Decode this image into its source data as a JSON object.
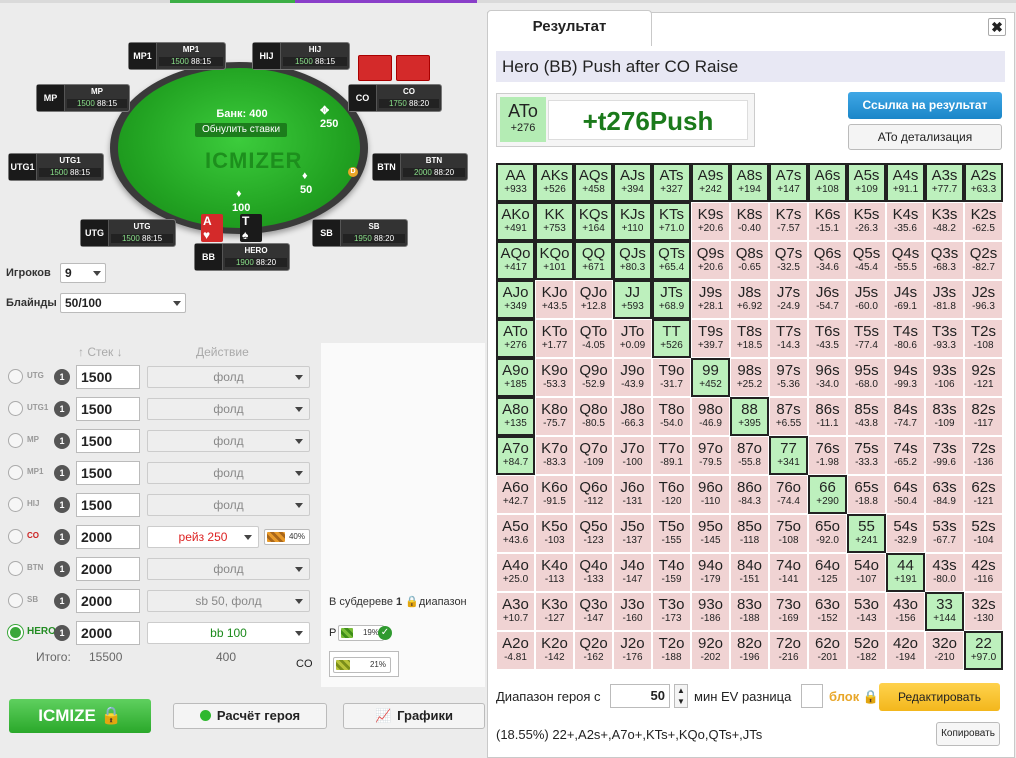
{
  "table": {
    "bank": "Банк: 400",
    "reset": "Обнулить ставки",
    "watermark": "ICMIZER",
    "pot_mp1": "250",
    "pot_btn": "50",
    "pot_hero": "100",
    "dealer": "D"
  },
  "seats": [
    {
      "key": "mp1",
      "pos": "MP1",
      "name": "MP1",
      "stack": "1500",
      "extra": "88:15"
    },
    {
      "key": "hij",
      "pos": "HIJ",
      "name": "HIJ",
      "stack": "1500",
      "extra": "88:15"
    },
    {
      "key": "mp",
      "pos": "MP",
      "name": "MP",
      "stack": "1500",
      "extra": "88:15"
    },
    {
      "key": "co",
      "pos": "CO",
      "name": "CO",
      "stack": "1750",
      "extra": "88:20"
    },
    {
      "key": "utg1",
      "pos": "UTG1",
      "name": "UTG1",
      "stack": "1500",
      "extra": "88:15"
    },
    {
      "key": "btn",
      "pos": "BTN",
      "name": "BTN",
      "stack": "2000",
      "extra": "88:20"
    },
    {
      "key": "utg",
      "pos": "UTG",
      "name": "UTG",
      "stack": "1500",
      "extra": "88:15"
    },
    {
      "key": "sb",
      "pos": "SB",
      "name": "SB",
      "stack": "1950",
      "extra": "88:20"
    },
    {
      "key": "bb",
      "pos": "BB",
      "name": "HERO",
      "stack": "1900",
      "extra": "88:20"
    }
  ],
  "hero_cards": [
    "A",
    "T"
  ],
  "settings": {
    "players_label": "Игроков",
    "players": "9",
    "blinds_label": "Блайнды",
    "blinds": "50/100"
  },
  "headers": {
    "stack": "↑ Стек ↓",
    "action": "Действие"
  },
  "players": [
    {
      "pos": "UTG",
      "num": "1",
      "stack": "1500",
      "action": "фолд"
    },
    {
      "pos": "UTG1",
      "num": "1",
      "stack": "1500",
      "action": "фолд"
    },
    {
      "pos": "MP",
      "num": "1",
      "stack": "1500",
      "action": "фолд"
    },
    {
      "pos": "MP1",
      "num": "1",
      "stack": "1500",
      "action": "фолд"
    },
    {
      "pos": "HIJ",
      "num": "1",
      "stack": "1500",
      "action": "фолд"
    },
    {
      "pos": "CO",
      "num": "1",
      "stack": "2000",
      "action": "рейз 250",
      "pct": "40%"
    },
    {
      "pos": "BTN",
      "num": "1",
      "stack": "2000",
      "action": "фолд"
    },
    {
      "pos": "SB",
      "num": "1",
      "stack": "2000",
      "action": "sb 50, фолд"
    },
    {
      "pos": "HERO",
      "num": "1",
      "stack": "2000",
      "action": "bb 100"
    }
  ],
  "totals": {
    "label": "Итого:",
    "stack": "15500",
    "action": "400"
  },
  "subtree": {
    "text_a": "В субдереве",
    "num": "1",
    "text_b": "диапазон",
    "p_label": "P",
    "p_pct": "19%",
    "co_label": "CO",
    "co_pct": "21%"
  },
  "buttons": {
    "icmize": "ICMIZE",
    "hero_calc": "Расчёт героя",
    "graphs": "Графики"
  },
  "result": {
    "tab": "Результат",
    "close": "✖",
    "title": "Hero (BB) Push after CO Raise",
    "hand": "ATo",
    "hand_ev": "+276",
    "decision": "+t276Push",
    "link_btn": "Ссылка на результат",
    "detail_btn": "ATo детализация",
    "range_label": "Диапазон героя с",
    "range_value": "50",
    "min_ev": "мин EV разница",
    "lock": "блок",
    "edit": "Редактировать",
    "range_text": "(18.55%) 22+,A2s+,A7o+,KTs+,KQo,QTs+,JTs",
    "copy": "Копировать",
    "grid": [
      [
        "AA",
        "+933",
        "g"
      ],
      [
        "AKs",
        "+526",
        "g"
      ],
      [
        "AQs",
        "+458",
        "g"
      ],
      [
        "AJs",
        "+394",
        "g"
      ],
      [
        "ATs",
        "+327",
        "g"
      ],
      [
        "A9s",
        "+242",
        "g"
      ],
      [
        "A8s",
        "+194",
        "g"
      ],
      [
        "A7s",
        "+147",
        "g"
      ],
      [
        "A6s",
        "+108",
        "g"
      ],
      [
        "A5s",
        "+109",
        "g"
      ],
      [
        "A4s",
        "+91.1",
        "g"
      ],
      [
        "A3s",
        "+77.7",
        "g"
      ],
      [
        "A2s",
        "+63.3",
        "g"
      ],
      [
        "AKo",
        "+491",
        "g"
      ],
      [
        "KK",
        "+753",
        "g"
      ],
      [
        "KQs",
        "+164",
        "g"
      ],
      [
        "KJs",
        "+110",
        "g"
      ],
      [
        "KTs",
        "+71.0",
        "g"
      ],
      [
        "K9s",
        "+20.6",
        "n"
      ],
      [
        "K8s",
        "-0.40",
        "n"
      ],
      [
        "K7s",
        "-7.57",
        "n"
      ],
      [
        "K6s",
        "-15.1",
        "n"
      ],
      [
        "K5s",
        "-26.3",
        "n"
      ],
      [
        "K4s",
        "-35.6",
        "n"
      ],
      [
        "K3s",
        "-48.2",
        "n"
      ],
      [
        "K2s",
        "-62.5",
        "n"
      ],
      [
        "AQo",
        "+417",
        "g"
      ],
      [
        "KQo",
        "+101",
        "g"
      ],
      [
        "QQ",
        "+671",
        "g"
      ],
      [
        "QJs",
        "+80.3",
        "g"
      ],
      [
        "QTs",
        "+65.4",
        "g"
      ],
      [
        "Q9s",
        "+20.6",
        "n"
      ],
      [
        "Q8s",
        "-0.65",
        "n"
      ],
      [
        "Q7s",
        "-32.5",
        "n"
      ],
      [
        "Q6s",
        "-34.6",
        "n"
      ],
      [
        "Q5s",
        "-45.4",
        "n"
      ],
      [
        "Q4s",
        "-55.5",
        "n"
      ],
      [
        "Q3s",
        "-68.3",
        "n"
      ],
      [
        "Q2s",
        "-82.7",
        "n"
      ],
      [
        "AJo",
        "+349",
        "g"
      ],
      [
        "KJo",
        "+43.5",
        "n"
      ],
      [
        "QJo",
        "+12.8",
        "n"
      ],
      [
        "JJ",
        "+593",
        "g"
      ],
      [
        "JTs",
        "+68.9",
        "g"
      ],
      [
        "J9s",
        "+28.1",
        "n"
      ],
      [
        "J8s",
        "+6.92",
        "n"
      ],
      [
        "J7s",
        "-24.9",
        "n"
      ],
      [
        "J6s",
        "-54.7",
        "n"
      ],
      [
        "J5s",
        "-60.0",
        "n"
      ],
      [
        "J4s",
        "-69.1",
        "n"
      ],
      [
        "J3s",
        "-81.8",
        "n"
      ],
      [
        "J2s",
        "-96.3",
        "n"
      ],
      [
        "ATo",
        "+276",
        "gh"
      ],
      [
        "KTo",
        "+1.77",
        "n"
      ],
      [
        "QTo",
        "-4.05",
        "n"
      ],
      [
        "JTo",
        "+0.09",
        "n"
      ],
      [
        "TT",
        "+526",
        "g"
      ],
      [
        "T9s",
        "+39.7",
        "n"
      ],
      [
        "T8s",
        "+18.5",
        "n"
      ],
      [
        "T7s",
        "-14.3",
        "n"
      ],
      [
        "T6s",
        "-43.5",
        "n"
      ],
      [
        "T5s",
        "-77.4",
        "n"
      ],
      [
        "T4s",
        "-80.6",
        "n"
      ],
      [
        "T3s",
        "-93.3",
        "n"
      ],
      [
        "T2s",
        "-108",
        "n"
      ],
      [
        "A9o",
        "+185",
        "g"
      ],
      [
        "K9o",
        "-53.3",
        "n"
      ],
      [
        "Q9o",
        "-52.9",
        "n"
      ],
      [
        "J9o",
        "-43.9",
        "n"
      ],
      [
        "T9o",
        "-31.7",
        "n"
      ],
      [
        "99",
        "+452",
        "g"
      ],
      [
        "98s",
        "+25.2",
        "n"
      ],
      [
        "97s",
        "-5.36",
        "n"
      ],
      [
        "96s",
        "-34.0",
        "n"
      ],
      [
        "95s",
        "-68.0",
        "n"
      ],
      [
        "94s",
        "-99.3",
        "n"
      ],
      [
        "93s",
        "-106",
        "n"
      ],
      [
        "92s",
        "-121",
        "n"
      ],
      [
        "A8o",
        "+135",
        "g"
      ],
      [
        "K8o",
        "-75.7",
        "n"
      ],
      [
        "Q8o",
        "-80.5",
        "n"
      ],
      [
        "J8o",
        "-66.3",
        "n"
      ],
      [
        "T8o",
        "-54.0",
        "n"
      ],
      [
        "98o",
        "-46.9",
        "n"
      ],
      [
        "88",
        "+395",
        "g"
      ],
      [
        "87s",
        "+6.55",
        "n"
      ],
      [
        "86s",
        "-11.1",
        "n"
      ],
      [
        "85s",
        "-43.8",
        "n"
      ],
      [
        "84s",
        "-74.7",
        "n"
      ],
      [
        "83s",
        "-109",
        "n"
      ],
      [
        "82s",
        "-117",
        "n"
      ],
      [
        "A7o",
        "+84.7",
        "g"
      ],
      [
        "K7o",
        "-83.3",
        "n"
      ],
      [
        "Q7o",
        "-109",
        "n"
      ],
      [
        "J7o",
        "-100",
        "n"
      ],
      [
        "T7o",
        "-89.1",
        "n"
      ],
      [
        "97o",
        "-79.5",
        "n"
      ],
      [
        "87o",
        "-55.8",
        "n"
      ],
      [
        "77",
        "+341",
        "g"
      ],
      [
        "76s",
        "-1.98",
        "n"
      ],
      [
        "75s",
        "-33.3",
        "n"
      ],
      [
        "74s",
        "-65.2",
        "n"
      ],
      [
        "73s",
        "-99.6",
        "n"
      ],
      [
        "72s",
        "-136",
        "n"
      ],
      [
        "A6o",
        "+42.7",
        "n"
      ],
      [
        "K6o",
        "-91.5",
        "n"
      ],
      [
        "Q6o",
        "-112",
        "n"
      ],
      [
        "J6o",
        "-131",
        "n"
      ],
      [
        "T6o",
        "-120",
        "n"
      ],
      [
        "96o",
        "-110",
        "n"
      ],
      [
        "86o",
        "-84.3",
        "n"
      ],
      [
        "76o",
        "-74.4",
        "n"
      ],
      [
        "66",
        "+290",
        "g"
      ],
      [
        "65s",
        "-18.8",
        "n"
      ],
      [
        "64s",
        "-50.4",
        "n"
      ],
      [
        "63s",
        "-84.9",
        "n"
      ],
      [
        "62s",
        "-121",
        "n"
      ],
      [
        "A5o",
        "+43.6",
        "n"
      ],
      [
        "K5o",
        "-103",
        "n"
      ],
      [
        "Q5o",
        "-123",
        "n"
      ],
      [
        "J5o",
        "-137",
        "n"
      ],
      [
        "T5o",
        "-155",
        "n"
      ],
      [
        "95o",
        "-145",
        "n"
      ],
      [
        "85o",
        "-118",
        "n"
      ],
      [
        "75o",
        "-108",
        "n"
      ],
      [
        "65o",
        "-92.0",
        "n"
      ],
      [
        "55",
        "+241",
        "g"
      ],
      [
        "54s",
        "-32.9",
        "n"
      ],
      [
        "53s",
        "-67.7",
        "n"
      ],
      [
        "52s",
        "-104",
        "n"
      ],
      [
        "A4o",
        "+25.0",
        "n"
      ],
      [
        "K4o",
        "-113",
        "n"
      ],
      [
        "Q4o",
        "-133",
        "n"
      ],
      [
        "J4o",
        "-147",
        "n"
      ],
      [
        "T4o",
        "-159",
        "n"
      ],
      [
        "94o",
        "-179",
        "n"
      ],
      [
        "84o",
        "-151",
        "n"
      ],
      [
        "74o",
        "-141",
        "n"
      ],
      [
        "64o",
        "-125",
        "n"
      ],
      [
        "54o",
        "-107",
        "n"
      ],
      [
        "44",
        "+191",
        "g"
      ],
      [
        "43s",
        "-80.0",
        "n"
      ],
      [
        "42s",
        "-116",
        "n"
      ],
      [
        "A3o",
        "+10.7",
        "n"
      ],
      [
        "K3o",
        "-127",
        "n"
      ],
      [
        "Q3o",
        "-147",
        "n"
      ],
      [
        "J3o",
        "-160",
        "n"
      ],
      [
        "T3o",
        "-173",
        "n"
      ],
      [
        "93o",
        "-186",
        "n"
      ],
      [
        "83o",
        "-188",
        "n"
      ],
      [
        "73o",
        "-169",
        "n"
      ],
      [
        "63o",
        "-152",
        "n"
      ],
      [
        "53o",
        "-143",
        "n"
      ],
      [
        "43o",
        "-156",
        "n"
      ],
      [
        "33",
        "+144",
        "g"
      ],
      [
        "32s",
        "-130",
        "n"
      ],
      [
        "A2o",
        "-4.81",
        "n"
      ],
      [
        "K2o",
        "-142",
        "n"
      ],
      [
        "Q2o",
        "-162",
        "n"
      ],
      [
        "J2o",
        "-176",
        "n"
      ],
      [
        "T2o",
        "-188",
        "n"
      ],
      [
        "92o",
        "-202",
        "n"
      ],
      [
        "82o",
        "-196",
        "n"
      ],
      [
        "72o",
        "-216",
        "n"
      ],
      [
        "62o",
        "-201",
        "n"
      ],
      [
        "52o",
        "-182",
        "n"
      ],
      [
        "42o",
        "-194",
        "n"
      ],
      [
        "32o",
        "-210",
        "n"
      ],
      [
        "22",
        "+97.0",
        "g"
      ]
    ]
  }
}
